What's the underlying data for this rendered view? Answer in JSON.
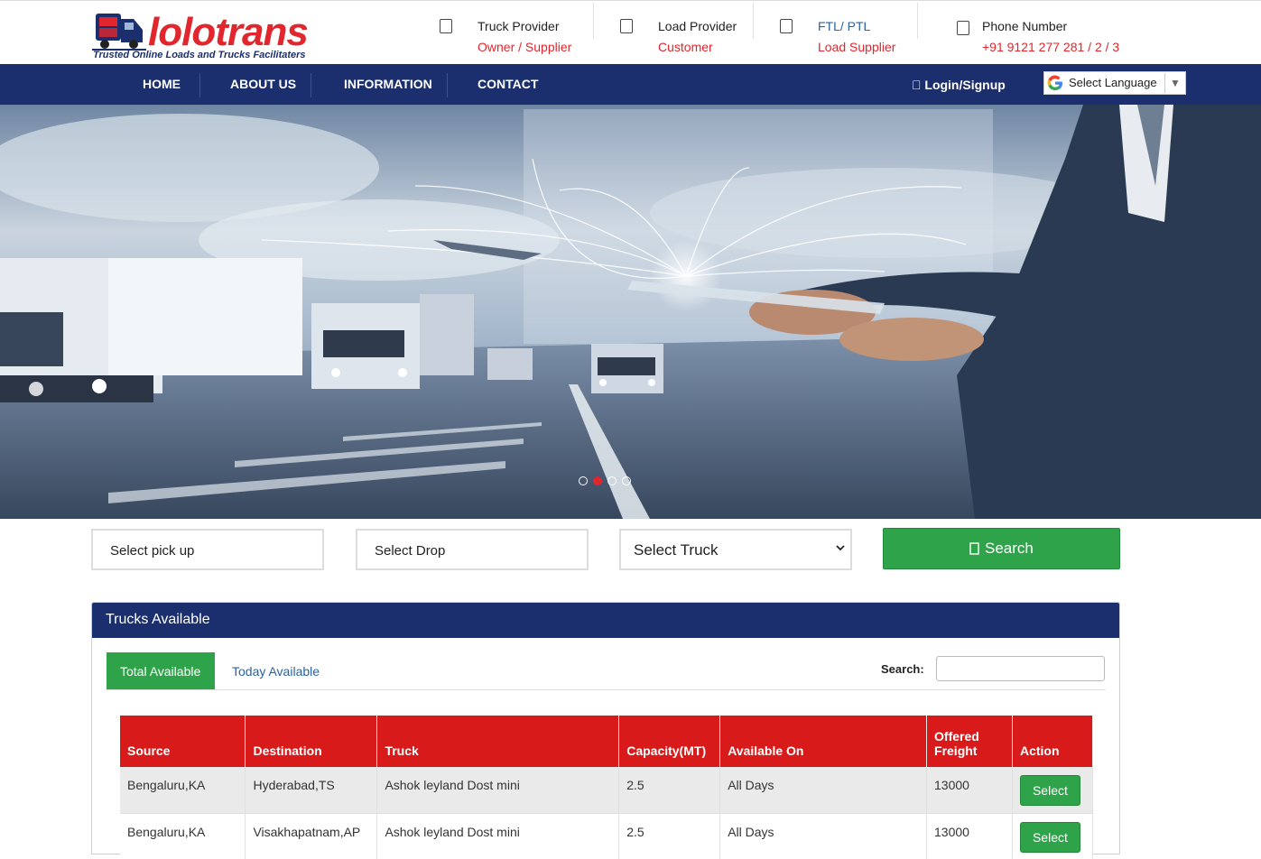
{
  "brand": {
    "name": "lolotrans",
    "tagline": "Trusted Online Loads and Trucks Facilitaters"
  },
  "header_info": [
    {
      "title": "Truck Provider",
      "sub": "Owner / Supplier"
    },
    {
      "title": "Load Provider",
      "sub": "Customer"
    },
    {
      "title": "FTL/ PTL",
      "sub": "Load Supplier"
    },
    {
      "title": "Phone Number",
      "sub": "+91 9121 277 281 / 2 / 3"
    }
  ],
  "nav": {
    "items": [
      "HOME",
      "ABOUT US",
      "INFORMATION",
      "CONTACT"
    ],
    "login": " Login/Signup",
    "language": "Select Language"
  },
  "carousel": {
    "slides": 4,
    "active": 2
  },
  "search": {
    "pickup_placeholder": "Select pick up",
    "drop_placeholder": "Select Drop",
    "truck_select": "Select Truck",
    "button": "Search"
  },
  "panel": {
    "title": "Trucks Available",
    "tabs": [
      "Total Available",
      "Today Available"
    ],
    "search_label": "Search:",
    "columns": [
      "Source",
      "Destination",
      "Truck",
      "Capacity(MT)",
      "Available On",
      "Offered Freight",
      "Action"
    ],
    "rows": [
      {
        "source": "Bengaluru,KA",
        "destination": "Hyderabad,TS",
        "truck": "Ashok leyland Dost mini",
        "capacity": "2.5",
        "available_on": "All Days",
        "freight": "13000",
        "action": "Select"
      },
      {
        "source": "Bengaluru,KA",
        "destination": "Visakhapatnam,AP",
        "truck": "Ashok leyland Dost mini",
        "capacity": "2.5",
        "available_on": "All Days",
        "freight": "13000",
        "action": "Select"
      }
    ]
  },
  "colors": {
    "navy": "#1b2f6e",
    "brand_red": "#e1262d",
    "green": "#2ea34a",
    "table_red": "#d91a1a"
  }
}
